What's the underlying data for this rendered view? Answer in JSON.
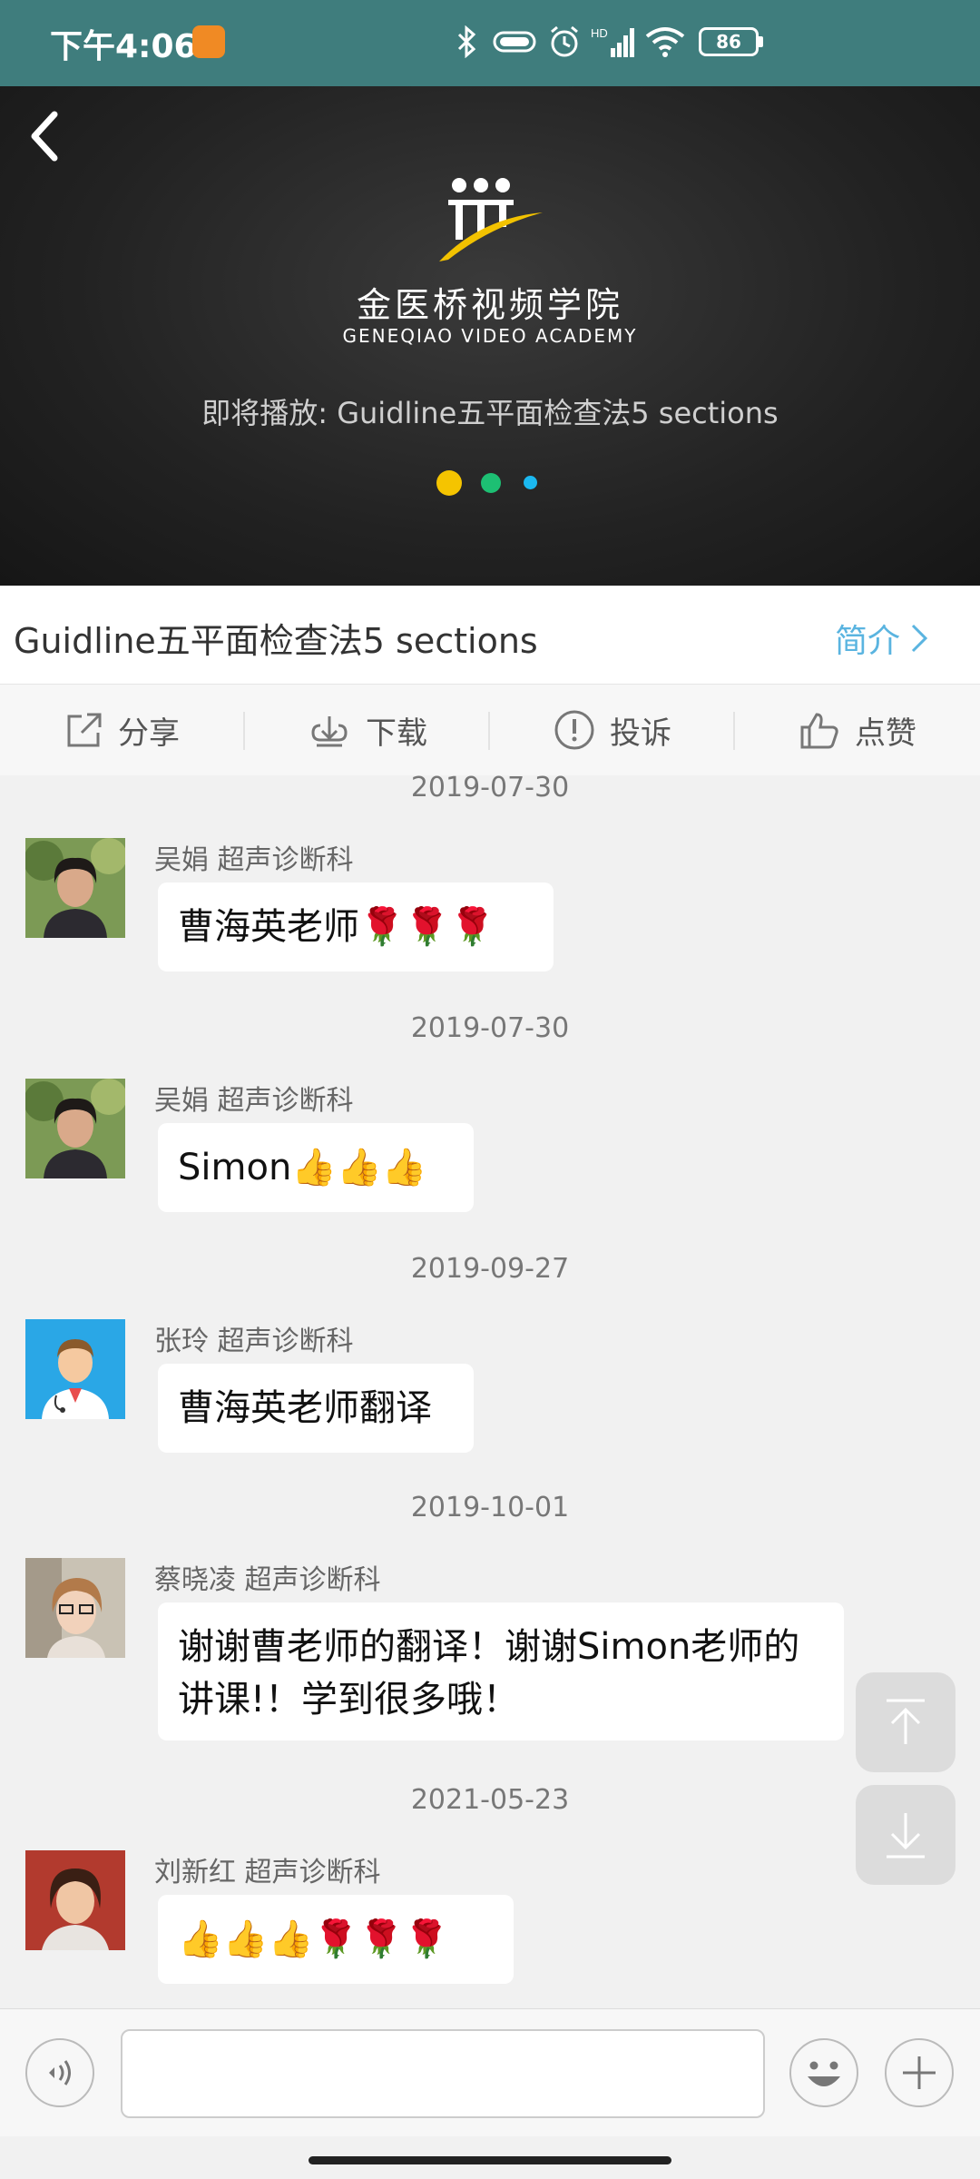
{
  "status_bar": {
    "time": "下午4:06",
    "battery": "86"
  },
  "video": {
    "logo_cn": "金医桥视频学院",
    "logo_en": "GENEQIAO VIDEO ACADEMY",
    "up_next": "即将播放: Guidline五平面检查法5 sections",
    "dot_colors": [
      "#f5c400",
      "#1dbf73",
      "#1bb8f0"
    ]
  },
  "title_row": {
    "title": "Guidline五平面检查法5 sections",
    "intro_label": "简介"
  },
  "actions": [
    {
      "icon": "share-icon",
      "label": "分享"
    },
    {
      "icon": "download-icon",
      "label": "下载"
    },
    {
      "icon": "report-icon",
      "label": "投诉"
    },
    {
      "icon": "like-icon",
      "label": "点赞"
    }
  ],
  "messages": [
    {
      "date": "2019-07-30",
      "name": "吴娟",
      "dept": "超声诊断科",
      "text": "曹海英老师🌹🌹🌹"
    },
    {
      "date": "2019-07-30",
      "name": "吴娟",
      "dept": "超声诊断科",
      "text": "Simon👍👍👍"
    },
    {
      "date": "2019-09-27",
      "name": "张玲",
      "dept": "超声诊断科",
      "text": "曹海英老师翻译"
    },
    {
      "date": "2019-10-01",
      "name": "蔡晓凌",
      "dept": "超声诊断科",
      "text": "谢谢曹老师的翻译！谢谢Simon老师的讲课!！学到很多哦！"
    },
    {
      "date": "2021-05-23",
      "name": "刘新红",
      "dept": "超声诊断科",
      "text": "👍👍👍🌹🌹🌹"
    }
  ],
  "input": {
    "placeholder": ""
  }
}
